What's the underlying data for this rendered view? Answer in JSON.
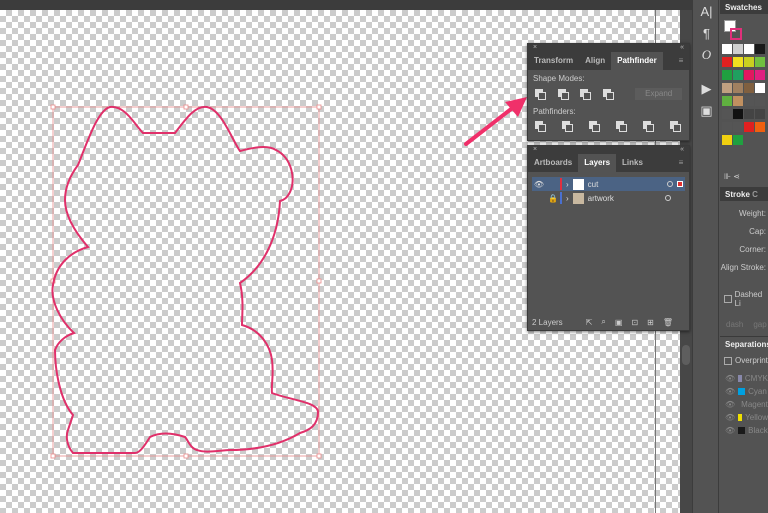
{
  "pathfinder_panel": {
    "tabs": [
      "Transform",
      "Align",
      "Pathfinder"
    ],
    "active_tab": "Pathfinder",
    "shape_modes_label": "Shape Modes:",
    "pathfinders_label": "Pathfinders:",
    "expand_label": "Expand"
  },
  "layers_panel": {
    "tabs": [
      "Artboards",
      "Layers",
      "Links"
    ],
    "active_tab": "Layers",
    "layers": [
      {
        "name": "cut",
        "visible": true,
        "locked": false,
        "color": "#e03040",
        "selected": true
      },
      {
        "name": "artwork",
        "visible": false,
        "locked": true,
        "color": "#4a70d0",
        "selected": false
      }
    ],
    "footer_count": "2 Layers"
  },
  "tools": {
    "items": [
      "A|",
      "¶",
      "O",
      "▶",
      "▣"
    ]
  },
  "swatches": {
    "title": "Swatches",
    "colors": [
      "#ffffff",
      "#d0d0d0",
      "#ffffff",
      "#1a1a1a",
      "#e02020",
      "#f0e020",
      "#c8d020",
      "#70c040",
      "#20a040",
      "#20a060",
      "#e01860",
      "#e02080",
      "#c0a080",
      "#a08060",
      "#806040",
      "#ffffff",
      "#60b040",
      "#c09060",
      "#555555",
      "#555555",
      "#555555",
      "#111111",
      "#444444",
      "#444444",
      "#555555",
      "#555555",
      "#e02020",
      "#f06010",
      "#f0d010",
      "#20a040"
    ]
  },
  "stroke": {
    "tab": "Stroke",
    "tab2": "C",
    "weight": "Weight:",
    "cap": "Cap:",
    "corner": "Corner:",
    "align": "Align Stroke:",
    "dashed": "Dashed Li",
    "dash": "dash",
    "gap": "gap"
  },
  "separations": {
    "title": "Separations",
    "overprint": "Overprint",
    "items": [
      {
        "name": "CMYK",
        "color": "#8888aa"
      },
      {
        "name": "Cyan",
        "color": "#00a0e0"
      },
      {
        "name": "Magenta",
        "color": "#e0007a"
      },
      {
        "name": "Yellow",
        "color": "#f0e000"
      },
      {
        "name": "Black",
        "color": "#1a1a1a"
      }
    ]
  },
  "colors": {
    "cut_path": "#e0306a",
    "arrow": "#f0306a",
    "selection": "#e88a8a"
  }
}
